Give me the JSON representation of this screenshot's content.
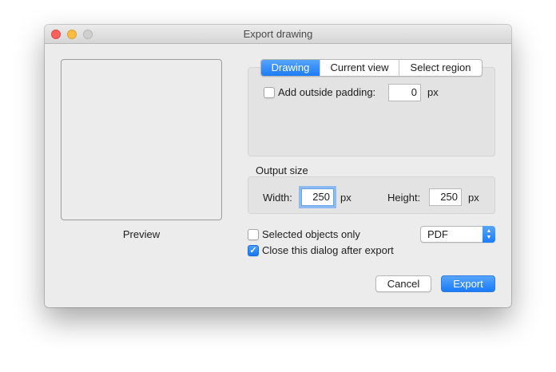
{
  "window": {
    "title": "Export drawing"
  },
  "preview": {
    "label": "Preview"
  },
  "tabs": [
    {
      "label": "Drawing",
      "active": true
    },
    {
      "label": "Current view",
      "active": false
    },
    {
      "label": "Select region",
      "active": false
    }
  ],
  "drawing_tab": {
    "padding_label": "Add outside padding:",
    "padding_checked": false,
    "padding_value": "0",
    "padding_unit": "px"
  },
  "output_size": {
    "title": "Output size",
    "width_label": "Width:",
    "width_value": "250",
    "width_unit": "px",
    "height_label": "Height:",
    "height_value": "250",
    "height_unit": "px"
  },
  "options": {
    "selected_only_label": "Selected objects only",
    "selected_only_checked": false,
    "close_after_label": "Close this dialog after export",
    "close_after_checked": true
  },
  "format": {
    "selected": "PDF"
  },
  "buttons": {
    "cancel": "Cancel",
    "export": "Export"
  },
  "colors": {
    "accent": "#1c7cf9",
    "window_bg": "#ececec"
  }
}
